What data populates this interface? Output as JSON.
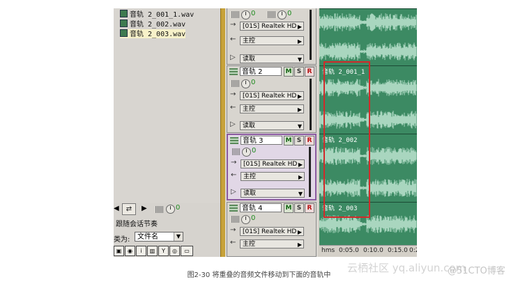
{
  "files": [
    "音轨 2_001_1.wav",
    "音轨 2_002.wav",
    "音轨 2_003.wav"
  ],
  "left_panel": {
    "volume_value": "0",
    "follow_label": "跟随会话节奏",
    "type_label": "类为:",
    "type_value": "文件名"
  },
  "tracks": [
    {
      "name": "",
      "vol": "0",
      "vol2": "0",
      "output": "[01S] Realtek HD",
      "bus": "主控",
      "mode": "读取"
    },
    {
      "name": "音轨 2",
      "vol": "0",
      "output": "[01S] Realtek HD",
      "bus": "主控",
      "mode": "读取"
    },
    {
      "name": "音轨 3",
      "vol": "0",
      "output": "[01S] Realtek HD",
      "bus": "主控",
      "mode": "读取"
    },
    {
      "name": "音轨 4",
      "vol": "0",
      "output": "[01S] Realtek HD",
      "bus": "主控"
    }
  ],
  "buttons": {
    "m": "M",
    "s": "S",
    "r": "R"
  },
  "clips": [
    "音轨 2_001_1",
    "音轨 2_002",
    "音轨 2_003"
  ],
  "ruler": [
    "hms",
    "0:05.0",
    "0:10.0",
    "0:15.0",
    "0:2"
  ],
  "caption": "图2-30 将重叠的音频文件移动到下面的音轨中",
  "watermark": "云栖社区 yq.aliyun.com",
  "watermark2": "@51CTO博客",
  "colors": {
    "timeline": "#2f7a57",
    "wave": "#a9d6bf",
    "highlight": "#d02a2a",
    "selected_track": "#8a5aa0"
  }
}
